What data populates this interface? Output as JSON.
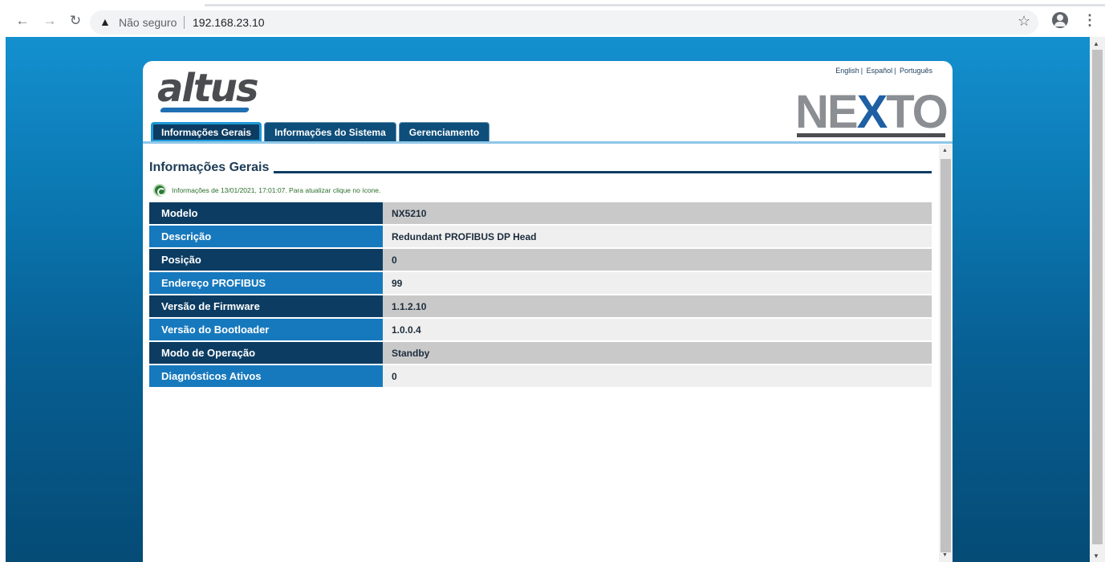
{
  "browser": {
    "security_label": "Não seguro",
    "url": "192.168.23.10"
  },
  "page": {
    "lang_links": [
      "English",
      "Español",
      "Português"
    ],
    "logo_text": "altus",
    "brand_text": "NEXTO",
    "tabs": [
      {
        "label": "Informações Gerais",
        "active": true
      },
      {
        "label": "Informações do Sistema",
        "active": false
      },
      {
        "label": "Gerenciamento",
        "active": false
      }
    ],
    "section_title": "Informações Gerais",
    "info_text": "Informações de 13/01/2021, 17:01:07. Para atualizar clique no ícone.",
    "rows": [
      {
        "label": "Modelo",
        "value": "NX5210"
      },
      {
        "label": "Descrição",
        "value": "Redundant PROFIBUS DP Head"
      },
      {
        "label": "Posição",
        "value": "0"
      },
      {
        "label": "Endereço PROFIBUS",
        "value": "99"
      },
      {
        "label": "Versão de Firmware",
        "value": "1.1.2.10"
      },
      {
        "label": "Versão do Bootloader",
        "value": "1.0.0.4"
      },
      {
        "label": "Modo de Operação",
        "value": "Standby"
      },
      {
        "label": "Diagnósticos Ativos",
        "value": "0"
      }
    ]
  },
  "colors": {
    "primary_dark": "#0c3c62",
    "primary_light": "#1779bd",
    "accent": "#8ec7e8"
  }
}
